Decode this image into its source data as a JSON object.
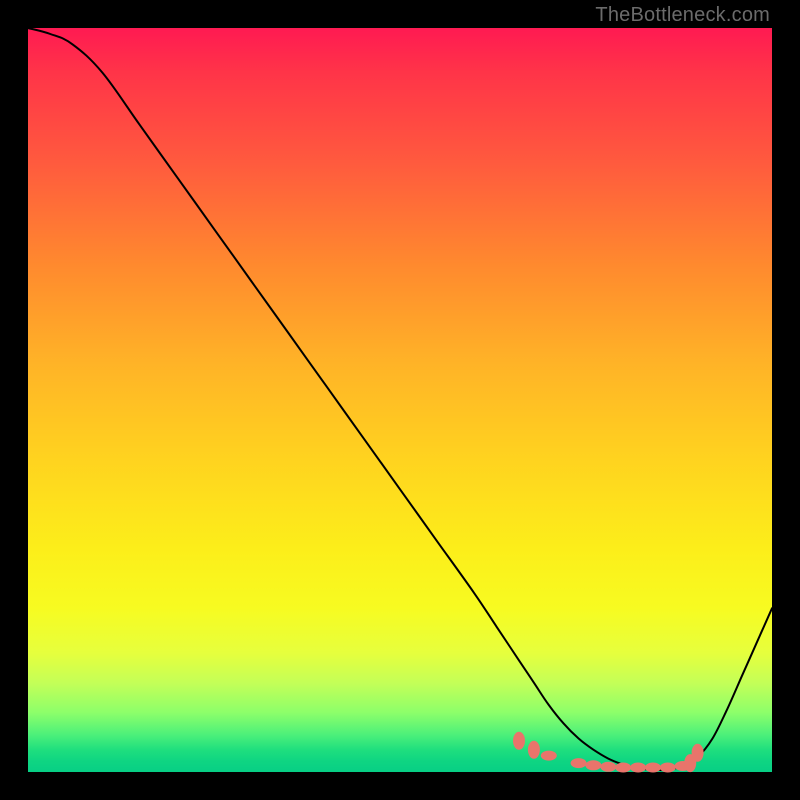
{
  "watermark": "TheBottleneck.com",
  "colors": {
    "frame": "#000000",
    "curve": "#000000",
    "marker": "#e9746b",
    "gradient_top": "#ff1a52",
    "gradient_bottom": "#07cf85"
  },
  "chart_data": {
    "type": "line",
    "title": "",
    "xlabel": "",
    "ylabel": "",
    "xlim": [
      0,
      100
    ],
    "ylim": [
      0,
      100
    ],
    "x": [
      0,
      3,
      6,
      10,
      15,
      20,
      25,
      30,
      35,
      40,
      45,
      50,
      55,
      60,
      63,
      66,
      68,
      70,
      72,
      74,
      76,
      78,
      80,
      82,
      84,
      86,
      88,
      90,
      92,
      94,
      96,
      98,
      100
    ],
    "y": [
      100,
      99.2,
      97.8,
      94.0,
      87.0,
      80.0,
      73.0,
      66.0,
      59.0,
      52.0,
      45.0,
      38.0,
      31.0,
      24.0,
      19.5,
      15.0,
      12.0,
      9.0,
      6.5,
      4.5,
      3.0,
      1.8,
      1.0,
      0.5,
      0.3,
      0.3,
      0.8,
      2.0,
      4.5,
      8.5,
      13.0,
      17.5,
      22.0
    ],
    "marker_x": [
      66,
      68,
      70,
      74,
      76,
      78,
      80,
      82,
      84,
      86,
      88,
      89,
      90
    ],
    "marker_y": [
      4.2,
      3.0,
      2.2,
      1.2,
      0.9,
      0.7,
      0.6,
      0.6,
      0.6,
      0.6,
      0.8,
      1.2,
      2.6
    ],
    "note": "y represents percent (0 at bottom, 100 at top) read approximately from the gradient; x is percent of horizontal span. Background encodes y via color gradient; no numeric axes are printed."
  }
}
